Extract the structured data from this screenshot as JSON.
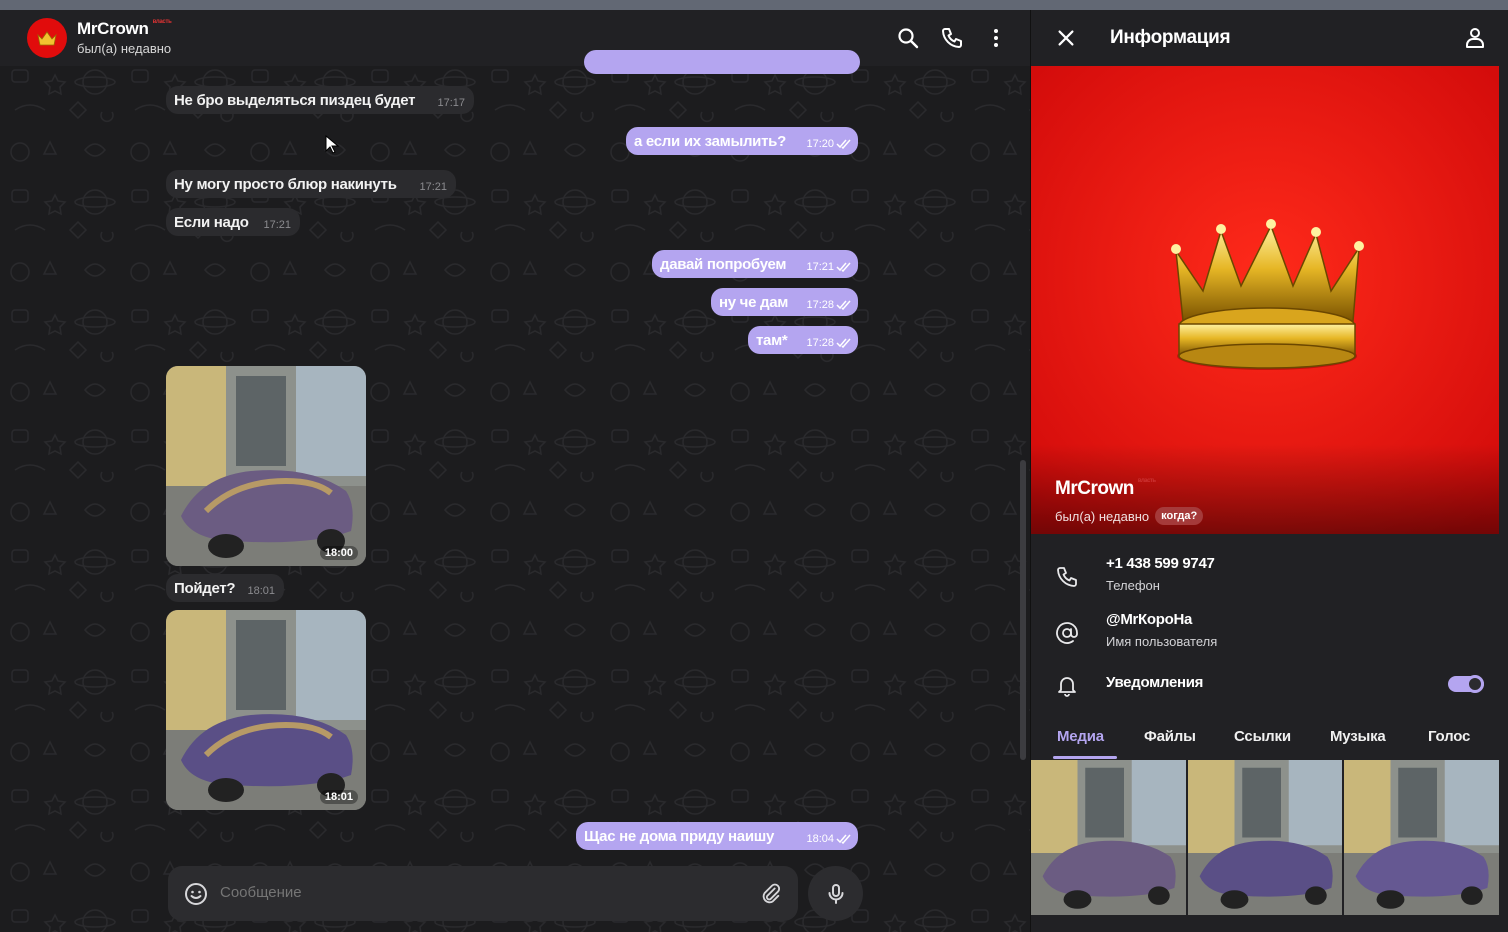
{
  "chat": {
    "header": {
      "title": "MrCrown",
      "title_sub": "власть",
      "status": "был(а) недавно",
      "icons": [
        "search-icon",
        "phone-icon",
        "more-vertical-icon"
      ]
    },
    "messages": [
      {
        "dir": "in",
        "text": "Не бро выделяться пиздец будет",
        "time": "17:17"
      },
      {
        "dir": "out",
        "text": "а если их замылить?",
        "time": "17:20"
      },
      {
        "dir": "in",
        "text": "Ну могу просто блюр накинуть",
        "time": "17:21"
      },
      {
        "dir": "in",
        "text": "Если надо",
        "time": "17:21"
      },
      {
        "dir": "out",
        "text": "давай попробуем",
        "time": "17:21"
      },
      {
        "dir": "out",
        "text": "ну че дам",
        "time": "17:28"
      },
      {
        "dir": "out",
        "text": "там*",
        "time": "17:28"
      },
      {
        "dir": "in",
        "type": "photo",
        "time": "18:00"
      },
      {
        "dir": "in",
        "text": "Пойдет?",
        "time": "18:01"
      },
      {
        "dir": "in",
        "type": "photo",
        "time": "18:01"
      },
      {
        "dir": "out",
        "text": "Щас не дома приду наишу",
        "time": "18:04"
      }
    ],
    "composer": {
      "placeholder": "Сообщение",
      "icons": [
        "emoji-icon",
        "attach-icon",
        "mic-icon"
      ]
    }
  },
  "info": {
    "title": "Информация",
    "name": "MrCrown",
    "name_sub": "власть",
    "status": "был(а) недавно",
    "badge": "когда?",
    "phone": {
      "value": "+1 438 599 9747",
      "label": "Телефон"
    },
    "username": {
      "value": "@MrКороНа",
      "label": "Имя пользователя"
    },
    "notifications": {
      "label": "Уведомления",
      "enabled": true
    },
    "tabs": [
      "Медиа",
      "Файлы",
      "Ссылки",
      "Музыка",
      "Голос"
    ],
    "active_tab": "Медиа",
    "media_count": 3
  },
  "colors": {
    "accent": "#b4a5f0",
    "avatar_red": "#e10c0c",
    "chat_bg": "#1c1c1e",
    "incoming_bubble": "#2b2b2e"
  }
}
